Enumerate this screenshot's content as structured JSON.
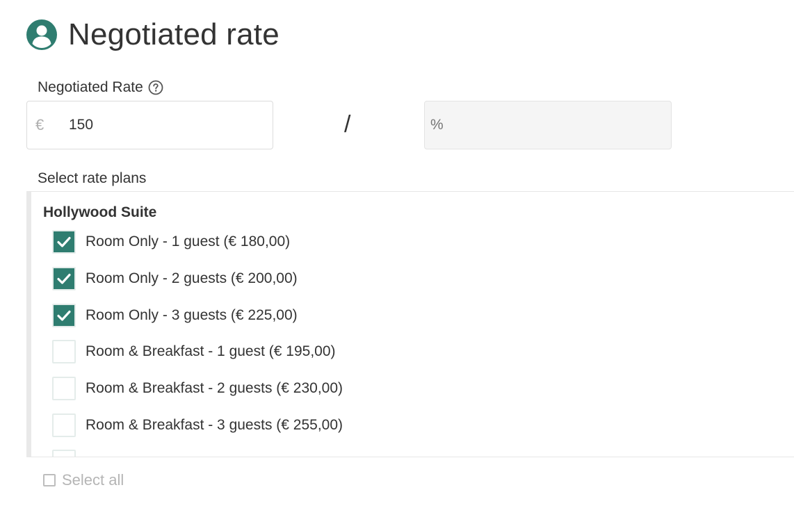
{
  "header": {
    "title": "Negotiated rate",
    "icon": "user-circle-icon",
    "accent_color": "#2f7d70"
  },
  "rate_field": {
    "label": "Negotiated Rate",
    "help_icon": "question-circle-icon",
    "currency_symbol": "€",
    "value": "150",
    "separator": "/",
    "percent_placeholder": "%"
  },
  "rate_plans": {
    "label": "Select rate plans",
    "group_title": "Hollywood Suite",
    "items": [
      {
        "label": "Room Only - 1 guest (€ 180,00)",
        "checked": true
      },
      {
        "label": "Room Only - 2 guests (€ 200,00)",
        "checked": true
      },
      {
        "label": "Room Only - 3 guests (€ 225,00)",
        "checked": true
      },
      {
        "label": "Room & Breakfast - 1 guest (€ 195,00)",
        "checked": false
      },
      {
        "label": "Room & Breakfast - 2 guests (€ 230,00)",
        "checked": false
      },
      {
        "label": "Room & Breakfast - 3 guests (€ 255,00)",
        "checked": false
      }
    ],
    "select_all_label": "Select all"
  }
}
